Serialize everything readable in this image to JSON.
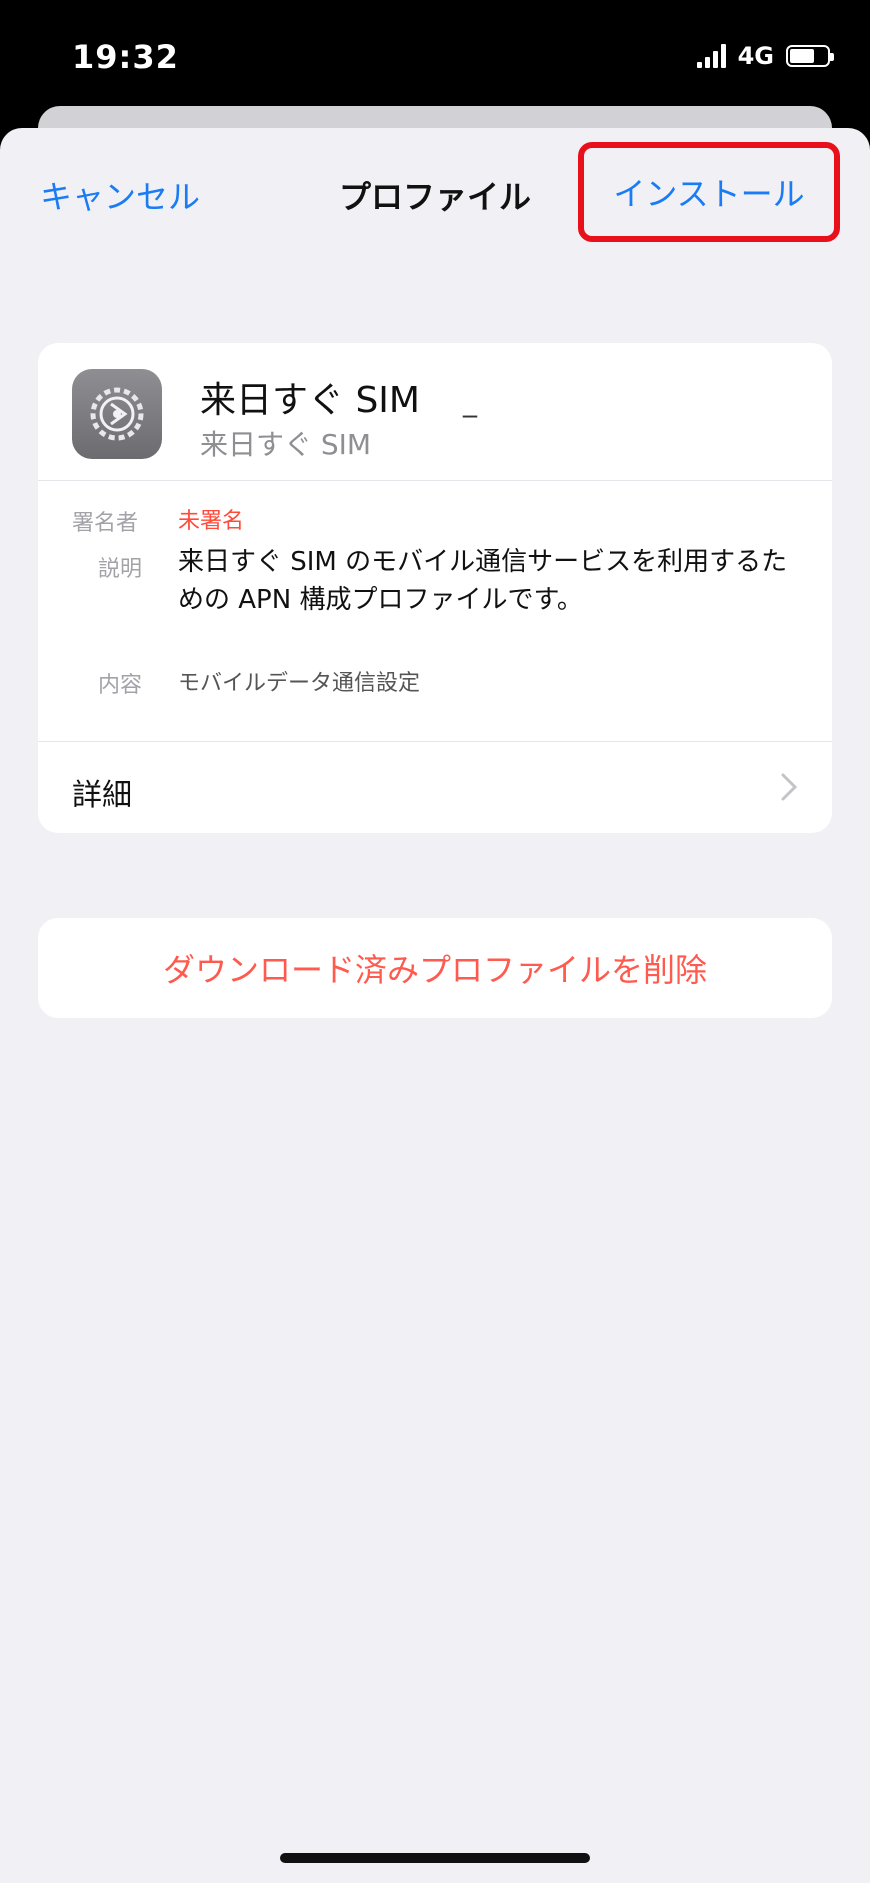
{
  "status_bar": {
    "time": "19:32",
    "network": "4G",
    "signal_icon": "cellular-signal-icon",
    "battery_icon": "battery-icon"
  },
  "nav": {
    "cancel_label": "キャンセル",
    "title": "プロファイル",
    "install_label": "インストール",
    "highlight_color": "#e8111b"
  },
  "profile": {
    "icon": "settings-gear-icon",
    "name": "来日すぐ SIM",
    "subtitle": "来日すぐ SIM",
    "signed_label": "署名者",
    "signed_value": "未署名",
    "description_label": "説明",
    "description_value": "来日すぐ SIM のモバイル通信サービスを利用するための APN 構成プロファイルです。",
    "contents_label": "内容",
    "contents_value": "モバイルデータ通信設定",
    "details_label": "詳細",
    "chevron_icon": "chevron-right-icon"
  },
  "actions": {
    "delete_label": "ダウンロード済みプロファイルを削除"
  },
  "colors": {
    "accent_blue": "#1a7cf5",
    "destructive_red": "#ff5a4e",
    "background": "#f0f0f5"
  }
}
